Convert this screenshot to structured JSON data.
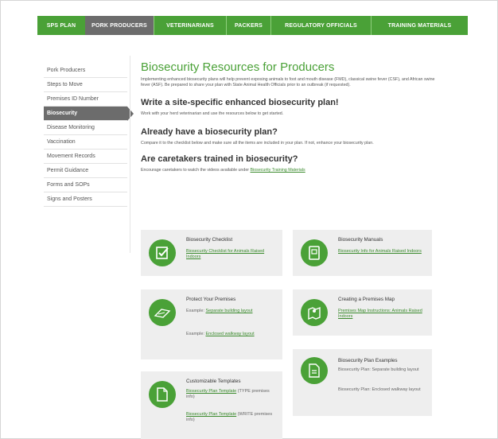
{
  "topnav": [
    {
      "label": "SPS PLAN"
    },
    {
      "label": "PORK PRODUCERS"
    },
    {
      "label": "VETERINARIANS"
    },
    {
      "label": "PACKERS"
    },
    {
      "label": "REGULATORY OFFICIALS"
    },
    {
      "label": "TRAINING MATERIALS"
    }
  ],
  "sidebar": {
    "items": [
      {
        "label": "Pork Producers"
      },
      {
        "label": "Steps to Move"
      },
      {
        "label": "Premises ID Number"
      },
      {
        "label": "Biosecurity"
      },
      {
        "label": "Disease Monitoring"
      },
      {
        "label": "Vaccination"
      },
      {
        "label": "Movement Records"
      },
      {
        "label": "Permit Guidance"
      },
      {
        "label": "Forms and SOPs"
      },
      {
        "label": "Signs and Posters"
      }
    ],
    "active_index": 3
  },
  "main": {
    "title": "Biosecurity Resources for Producers",
    "intro": "Implementing enhanced biosecurity plans will help prevent exposing animals to foot and mouth disease (FMD), classical swine fever (CSF), and African swine fever (ASF). Be prepared to share your plan with State Animal Health Officials prior to an outbreak (if requested).",
    "s1_heading": "Write a site-specific enhanced biosecurity plan!",
    "s1_text": "Work with your herd veterinarian and use the resources below to get started.",
    "s2_heading": "Already have a biosecurity plan?",
    "s2_text": "Compare it to the checklist below and make sure all the items are included in your plan. If not, enhance your biosecurity plan.",
    "s3_heading": "Are caretakers trained in biosecurity?",
    "s3_text_pre": "Encourage caretakers to watch the videos available under ",
    "s3_link": "Biosecurity Training Materials"
  },
  "cards": {
    "checklist": {
      "title": "Biosecurity Checklist",
      "link": "Biosecurity Checklist for Animals Raised Indoors",
      "icon": "checklist-icon"
    },
    "manuals": {
      "title": "Biosecurity Manuals",
      "link": "Biosecurity Info for Animals Raised Indoors",
      "icon": "manual-icon"
    },
    "protect": {
      "title": "Protect Your Premises",
      "ex1_pre": "Example: ",
      "ex1_link": "Separate building layout",
      "ex2_pre": "Example: ",
      "ex2_link": "Enclosed walkway layout",
      "icon": "building-icon"
    },
    "map": {
      "title": "Creating a Premises Map",
      "link": "Premises Map Instructions: Animals Raised Indoors",
      "icon": "map-icon"
    },
    "examples": {
      "title": "Biosecurity Plan Examples",
      "t1": "Biosecurity Plan: Separate building layout",
      "t2": "Biosecurity Plan: Enclosed walkway layout",
      "icon": "pdf-icon"
    },
    "templates": {
      "title": "Customizable Templates",
      "l1": "Biosecurity Plan Template",
      "t1": " (TYPE premises info)",
      "l2": "Biosecurity Plan Template",
      "t2": " (WRITE premises info)",
      "icon": "document-icon"
    }
  }
}
